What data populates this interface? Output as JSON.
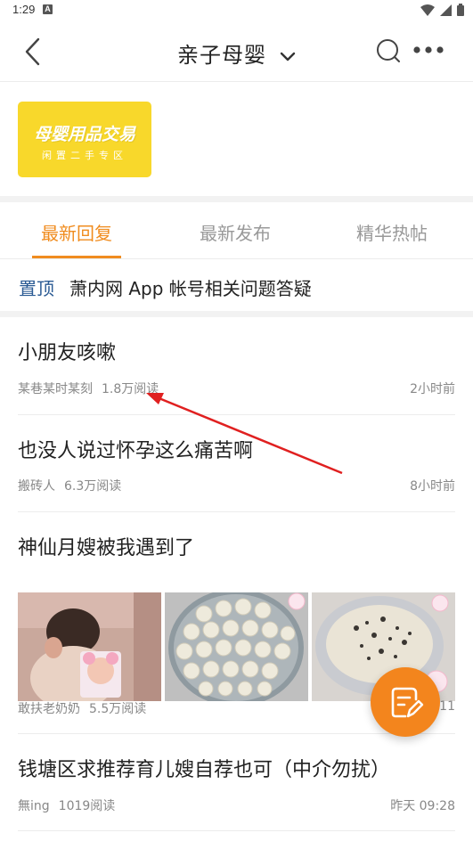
{
  "status": {
    "time": "1:29",
    "a_icon": "A"
  },
  "header": {
    "title": "亲子母婴"
  },
  "banner": {
    "line1": "母婴用品交易",
    "line2": "闲置二手专区"
  },
  "tabs": [
    {
      "label": "最新回复",
      "active": true
    },
    {
      "label": "最新发布",
      "active": false
    },
    {
      "label": "精华热帖",
      "active": false
    }
  ],
  "pinned": {
    "tag": "置顶",
    "text": "萧内网 App 帐号相关问题答疑"
  },
  "posts": [
    {
      "title": "小朋友咳嗽",
      "author": "某巷某时某刻",
      "reads": "1.8万阅读",
      "time": "2小时前"
    },
    {
      "title": "也没人说过怀孕这么痛苦啊",
      "author": "搬砖人",
      "reads": "6.3万阅读",
      "time": "8小时前"
    },
    {
      "title": "神仙月嫂被我遇到了",
      "author": "敢扶老奶奶",
      "reads": "5.5万阅读",
      "time": "11"
    },
    {
      "title": "钱塘区求推荐育儿嫂自荐也可（中介勿扰）",
      "author": "無ing",
      "reads": "1019阅读",
      "time": "昨天 09:28"
    }
  ],
  "colors": {
    "accent": "#f08c1f",
    "pin": "#2b5b94",
    "banner": "#f8d82b",
    "fab": "#f3851d",
    "annotation": "#e02020"
  },
  "icons": [
    "back-arrow-icon",
    "chevron-down-icon",
    "search-icon",
    "more-dots-icon",
    "compose-icon",
    "wifi-icon",
    "signal-icon",
    "battery-icon"
  ]
}
